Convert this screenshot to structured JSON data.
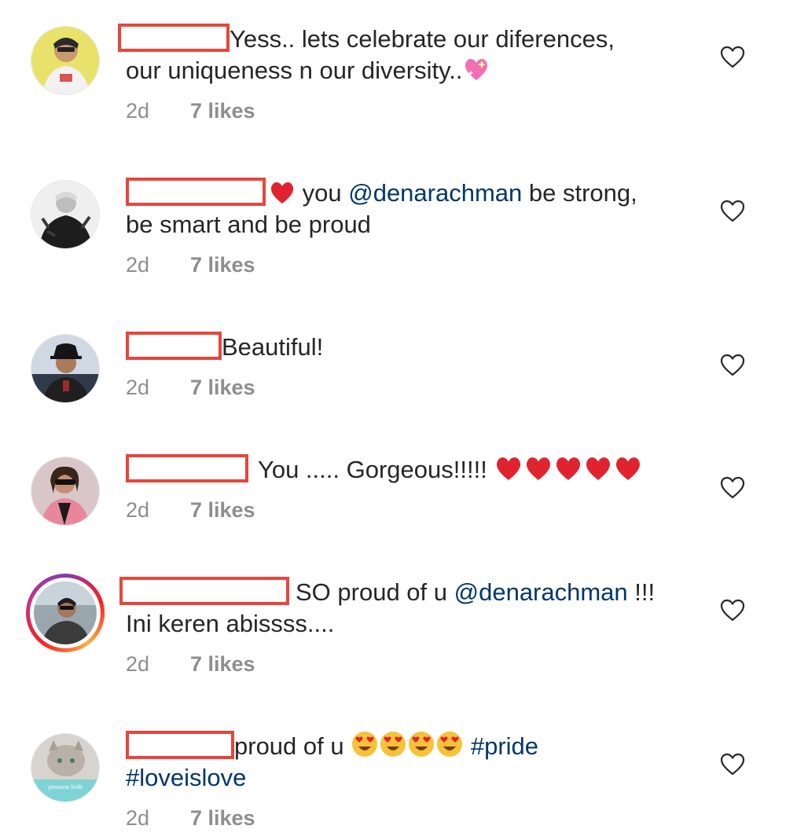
{
  "comments": [
    {
      "avatar": "avatar-boy-yellow",
      "text_parts": [
        "Yess.. lets celebrate our diferences,",
        "our uniqueness n our diversity..",
        "sparkling-heart-emoji"
      ],
      "time": "2d",
      "likes": "7 likes"
    },
    {
      "avatar": "avatar-bw-portrait",
      "text_parts": [
        "red-heart-emoji",
        "you ",
        "@denarachman",
        " be strong,",
        "be smart and be proud"
      ],
      "time": "2d",
      "likes": "7 likes"
    },
    {
      "avatar": "avatar-man-cap",
      "text_parts": [
        "Beautiful!"
      ],
      "time": "2d",
      "likes": "7 likes"
    },
    {
      "avatar": "avatar-woman-sunglasses",
      "text_parts": [
        "You ..... Gorgeous!!!!!",
        "red-heart-emoji x5"
      ],
      "time": "2d",
      "likes": "7 likes"
    },
    {
      "avatar": "avatar-story-ring",
      "text_parts": [
        "SO proud of u ",
        "@denarachman",
        " !!!",
        "Ini keren abissss...."
      ],
      "time": "2d",
      "likes": "7 likes"
    },
    {
      "avatar": "avatar-cat-penawar",
      "avatar_caption": "penawar letih",
      "text_parts": [
        "proud of u ",
        "heart-eyes-emoji x4",
        " #pride",
        "#loveislove"
      ],
      "time": "2d",
      "likes": "7 likes"
    }
  ],
  "colors": {
    "text": "#262626",
    "meta": "#8e8e8e",
    "link": "#00376b",
    "redaction": "#e8453c",
    "heart": "#e0245e"
  },
  "icons": {
    "like": "heart-outline-icon"
  }
}
